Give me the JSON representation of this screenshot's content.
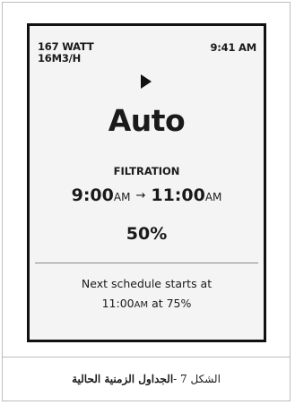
{
  "status": {
    "power": "167 WATT",
    "flow": "16M3/H",
    "time": "9:41 AM"
  },
  "play_icon": "play-icon",
  "mode": "Auto",
  "program_label": "FILTRATION",
  "schedule": {
    "start": "9:00",
    "start_suffix": "AM",
    "arrow": "→",
    "end": "11:00",
    "end_suffix": "AM"
  },
  "speed": "50%",
  "next": {
    "line1": "Next schedule starts at",
    "time": "11:00",
    "suffix": "AM",
    "rest": " at 75%"
  },
  "caption": {
    "prefix": "الشكل 7 - ",
    "title": "الجداول الزمنية الحالية"
  }
}
